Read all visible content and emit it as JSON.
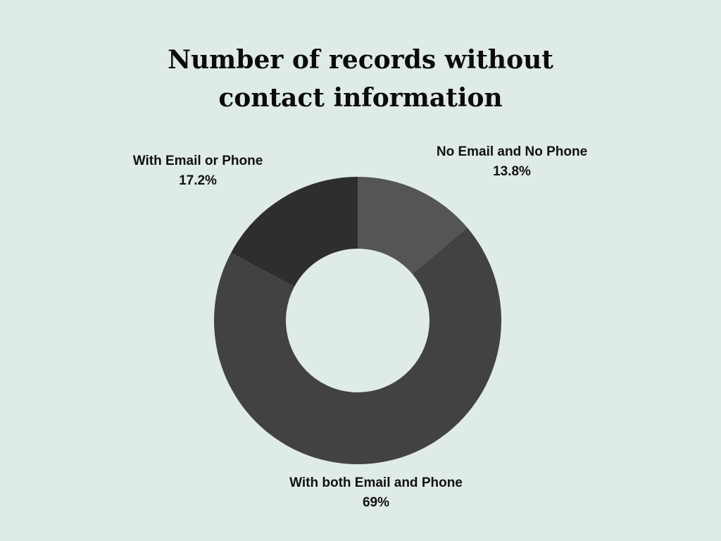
{
  "chart_data": {
    "type": "pie",
    "title": "Number of records without contact information",
    "donut": true,
    "start_angle_deg": 0,
    "direction": "clockwise",
    "slices": [
      {
        "label": "No Email and No Phone",
        "value": 13.8,
        "value_label": "13.8%",
        "color": "#555555"
      },
      {
        "label": "With both Email and Phone",
        "value": 69,
        "value_label": "69%",
        "color": "#424242"
      },
      {
        "label": "With Email or Phone",
        "value": 17.2,
        "value_label": "17.2%",
        "color": "#2e2e2e"
      }
    ],
    "legend": "none",
    "background": "#dfebe7"
  }
}
